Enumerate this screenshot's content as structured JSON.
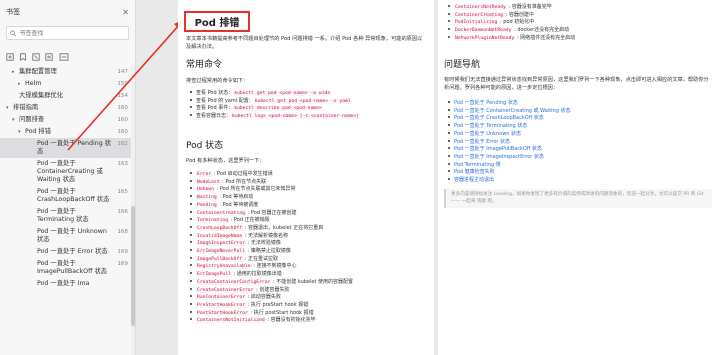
{
  "sidebar": {
    "title": "书签",
    "search_placeholder": "书签查找",
    "items": [
      {
        "label": "集群配置管理",
        "page": "147",
        "indent": 1,
        "twisty": "▸"
      },
      {
        "label": "Helm",
        "page": "150",
        "indent": 2,
        "twisty": "▸"
      },
      {
        "label": "大规模集群优化",
        "page": "154",
        "indent": 1,
        "twisty": ""
      },
      {
        "label": "排错指南",
        "page": "160",
        "indent": 0,
        "twisty": "▾"
      },
      {
        "label": "问题排查",
        "page": "160",
        "indent": 1,
        "twisty": "▾"
      },
      {
        "label": "Pod 排错",
        "page": "160",
        "indent": 2,
        "twisty": "▾"
      },
      {
        "label": "Pod 一直处于 Pending 状态",
        "page": "162",
        "indent": 3,
        "twisty": "",
        "active": true
      },
      {
        "label": "Pod 一直处于 ContainerCreating 或 Waiting 状态",
        "page": "163",
        "indent": 3,
        "twisty": ""
      },
      {
        "label": "Pod 一直处于 CrashLoopBackOff 状态",
        "page": "165",
        "indent": 3,
        "twisty": ""
      },
      {
        "label": "Pod 一直处于 Terminating 状态",
        "page": "166",
        "indent": 3,
        "twisty": ""
      },
      {
        "label": "Pod 一直处于 Unknown 状态",
        "page": "168",
        "indent": 3,
        "twisty": ""
      },
      {
        "label": "Pod 一直处于 Error 状态",
        "page": "169",
        "indent": 3,
        "twisty": ""
      },
      {
        "label": "Pod 一直处于 ImagePullBackOff 状态",
        "page": "169",
        "indent": 3,
        "twisty": ""
      },
      {
        "label": "Pod 一直处于 Ima",
        "page": "",
        "indent": 3,
        "twisty": ""
      }
    ]
  },
  "left_page": {
    "title": "Pod 排错",
    "intro": "本文章本书籍提高参考不同题目处理节的 Pod 问题排错 一系。介绍 Pod 各种 异常现象，可能的原因以及解决办法。",
    "section1": "常用命令",
    "section1_intro": "排查过程常用的命令如下：",
    "commands": [
      {
        "label": "查看 Pod 状态：",
        "code": "kubectl get pod <pod-name> -o wide"
      },
      {
        "label": "查看 Pod 的 yaml 配置：",
        "code": "kubectl get pod <pod-name> -o yaml"
      },
      {
        "label": "查看 Pod 事件：",
        "code": "kubectl describe pod <pod-name>"
      },
      {
        "label": "查看容器日志：",
        "code": "kubectl logs <pod-name> [-c <container-name>]"
      }
    ],
    "section2": "Pod 状态",
    "section2_intro": "Pod 有多种状态，这里罗列一下：",
    "states": [
      {
        "code": "Error",
        "desc": "Pod 启动过程中发生错误"
      },
      {
        "code": "NodeLost",
        "desc": "Pod 所在节点失联"
      },
      {
        "code": "Unkown",
        "desc": "Pod 所在节点失联或其它未知异常"
      },
      {
        "code": "Waiting",
        "desc": "Pod 等待启动"
      },
      {
        "code": "Pending",
        "desc": "Pod 等待被调度"
      },
      {
        "code": "ContainerCreating",
        "desc": "Pod 容器正在被创建"
      },
      {
        "code": "Terminating",
        "desc": "Pod 正在被销毁"
      },
      {
        "code": "CrashLoopBackOff",
        "desc": "容器退出，kubelet 正在将它重启"
      },
      {
        "code": "InvalidImageName",
        "desc": "无法解析镜像名称"
      },
      {
        "code": "ImageInspectError",
        "desc": "无法校验镜像"
      },
      {
        "code": "ErrImageNeverPull",
        "desc": "策略禁止拉取镜像"
      },
      {
        "code": "ImagePullBackOff",
        "desc": "正在重试拉取"
      },
      {
        "code": "RegistryUnavailable",
        "desc": "连接不到镜像中心"
      },
      {
        "code": "ErrImagePull",
        "desc": "通用的拉取镜像出错"
      },
      {
        "code": "CreateContainerConfigError",
        "desc": "不能创建 kubelet 使用的容器配置"
      },
      {
        "code": "CreateContainerError",
        "desc": "创建容器失败"
      },
      {
        "code": "RunContainerError",
        "desc": "启动容器失败"
      },
      {
        "code": "PreStartHookError",
        "desc": "执行 preStart hook 报错"
      },
      {
        "code": "PostStartHookError",
        "desc": "执行 postStart hook 报错"
      },
      {
        "code": "ContainersNotInitialized",
        "desc": "容器没有初始化完毕"
      }
    ]
  },
  "right_page": {
    "top_states": [
      {
        "code": "ContainersNotReady",
        "desc": "容器没有准备完毕"
      },
      {
        "code": "ContainerCreating",
        "desc": "容器创建中"
      },
      {
        "code": "PodInitializing",
        "desc": "pod 初始化中"
      },
      {
        "code": "DockerDaemonNotReady",
        "desc": "docker还没有完全启动"
      },
      {
        "code": "NetworkPluginNotReady",
        "desc": "网络插件还没有完全启动"
      }
    ],
    "section": "问题导航",
    "section_intro": "有时候我们无法直接通过异常状态找到异常原因，这里我们罗列一下各种现象，点击即可进入相应的文章，帮助你分析问题，罗列各种可能的原因，进一步定位根因：",
    "links": [
      "Pod 一直处于 Pending 状态",
      "Pod 一直处于 ContainerCreating 或 Waiting 状态",
      "Pod 一直处于 CrashLoopBackOff 状态",
      "Pod 一直处于 Terminating 状态",
      "Pod 一直处于 Unknown 状态",
      "Pod 一直处于 Error 状态",
      "Pod 一直处于 ImagePullBackOff 状态",
      "Pod 一直处于 ImageInspectError 状态",
      "Pod Terminating 慢",
      "Pod 健康检查失败",
      "容器进程主动退出"
    ],
    "note": "更多内容请持续关注 Loading，如果你发现了更多有价值的案例或改进的问题现象的，欢迎一起分享，也可以提交 PR 到 Git —— 一起来 贡献 吧。"
  },
  "colors": {
    "accent_red": "#e5322d",
    "link_blue": "#2a6fd8",
    "code_red": "#d14"
  }
}
